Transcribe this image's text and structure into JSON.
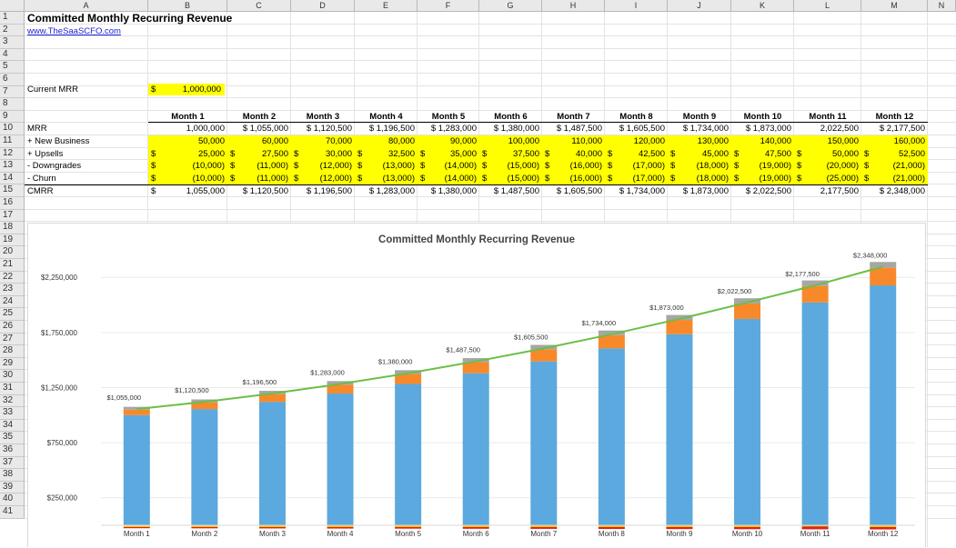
{
  "columns": [
    "A",
    "B",
    "C",
    "D",
    "E",
    "F",
    "G",
    "H",
    "I",
    "J",
    "K",
    "L",
    "M",
    "N"
  ],
  "rows": [
    "1",
    "2",
    "3",
    "4",
    "5",
    "6",
    "7",
    "8",
    "9",
    "10",
    "11",
    "12",
    "13",
    "14",
    "15",
    "16",
    "17",
    "18",
    "19",
    "20",
    "21",
    "22",
    "23",
    "24",
    "25",
    "26",
    "27",
    "28",
    "29",
    "30",
    "31",
    "32",
    "33",
    "34",
    "35",
    "36",
    "37",
    "38",
    "39",
    "40",
    "41"
  ],
  "sheet": {
    "title": "Committed Monthly Recurring Revenue",
    "link": "www.TheSaaSCFO.com",
    "current_mrr_label": "Current MRR",
    "current_mrr_dollar": "$",
    "current_mrr_value": "1,000,000",
    "months": [
      "Month 1",
      "Month 2",
      "Month 3",
      "Month 4",
      "Month 5",
      "Month 6",
      "Month 7",
      "Month 8",
      "Month 9",
      "Month 10",
      "Month 11",
      "Month 12"
    ],
    "row_labels": {
      "mrr": "MRR",
      "new": "+ New Business",
      "upsells": "+ Upsells",
      "downgrades": "- Downgrades",
      "churn": "- Churn",
      "cmrr": "CMRR"
    },
    "data": {
      "mrr": [
        "1,000,000",
        "$ 1,055,000",
        "$ 1,120,500",
        "$ 1,196,500",
        "$ 1,283,000",
        "$ 1,380,000",
        "$ 1,487,500",
        "$ 1,605,500",
        "$ 1,734,000",
        "$ 1,873,000",
        "2,022,500",
        "$ 2,177,500"
      ],
      "new": [
        "50,000",
        "60,000",
        "70,000",
        "80,000",
        "90,000",
        "100,000",
        "110,000",
        "120,000",
        "130,000",
        "140,000",
        "150,000",
        "160,000"
      ],
      "upsells": [
        "25,000",
        "27,500",
        "30,000",
        "32,500",
        "35,000",
        "37,500",
        "40,000",
        "42,500",
        "45,000",
        "47,500",
        "50,000",
        "52,500"
      ],
      "downgrades": [
        "(10,000)",
        "(11,000)",
        "(12,000)",
        "(13,000)",
        "(14,000)",
        "(15,000)",
        "(16,000)",
        "(17,000)",
        "(18,000)",
        "(19,000)",
        "(20,000)",
        "(21,000)"
      ],
      "churn": [
        "(10,000)",
        "(11,000)",
        "(12,000)",
        "(13,000)",
        "(14,000)",
        "(15,000)",
        "(16,000)",
        "(17,000)",
        "(18,000)",
        "(19,000)",
        "(25,000)",
        "(21,000)"
      ],
      "cmrr": [
        "1,055,000",
        "$ 1,120,500",
        "$ 1,196,500",
        "$ 1,283,000",
        "$ 1,380,000",
        "$ 1,487,500",
        "$ 1,605,500",
        "$ 1,734,000",
        "$ 1,873,000",
        "$ 2,022,500",
        "2,177,500",
        "$ 2,348,000"
      ]
    }
  },
  "chart_data": {
    "type": "bar",
    "title": "Committed Monthly Recurring Revenue",
    "categories": [
      "Month 1",
      "Month 2",
      "Month 3",
      "Month 4",
      "Month 5",
      "Month 6",
      "Month 7",
      "Month 8",
      "Month 9",
      "Month 10",
      "Month 11",
      "Month 12"
    ],
    "stacked": true,
    "series": [
      {
        "values": [
          1000000,
          1055000,
          1120500,
          1196500,
          1283000,
          1380000,
          1487500,
          1605500,
          1734000,
          1873000,
          2022500,
          2177500
        ],
        "color": "#5ba9de"
      },
      {
        "values": [
          50000,
          60000,
          70000,
          80000,
          90000,
          100000,
          110000,
          120000,
          130000,
          140000,
          150000,
          160000
        ],
        "color": "#f7892a"
      },
      {
        "values": [
          25000,
          27500,
          30000,
          32500,
          35000,
          37500,
          40000,
          42500,
          45000,
          47500,
          50000,
          52500
        ],
        "color": "#a6a6a6"
      },
      {
        "values": [
          -10000,
          -11000,
          -12000,
          -13000,
          -14000,
          -15000,
          -16000,
          -17000,
          -18000,
          -19000,
          -20000,
          -21000
        ],
        "color": "#f2c500"
      },
      {
        "values": [
          -10000,
          -11000,
          -12000,
          -13000,
          -14000,
          -15000,
          -16000,
          -17000,
          -18000,
          -19000,
          -25000,
          -21000
        ],
        "color": "#e02020"
      }
    ],
    "line": {
      "values": [
        1055000,
        1120500,
        1196500,
        1283000,
        1380000,
        1487500,
        1605500,
        1734000,
        1873000,
        2022500,
        2177500,
        2348000
      ],
      "color": "#6abf47"
    },
    "data_labels": [
      "$1,055,000",
      "$1,120,500",
      "$1,196,500",
      "$1,283,000",
      "$1,380,000",
      "$1,487,500",
      "$1,605,500",
      "$1,734,000",
      "$1,873,000",
      "$2,022,500",
      "$2,177,500",
      "$2,348,000"
    ],
    "y_ticks": [
      250000,
      750000,
      1250000,
      1750000,
      2250000
    ],
    "y_tick_labels": [
      "$250,000",
      "$750,000",
      "$1,250,000",
      "$1,750,000",
      "$2,250,000"
    ],
    "ylim": [
      0,
      2450000
    ],
    "grid": true,
    "legend": "none"
  }
}
